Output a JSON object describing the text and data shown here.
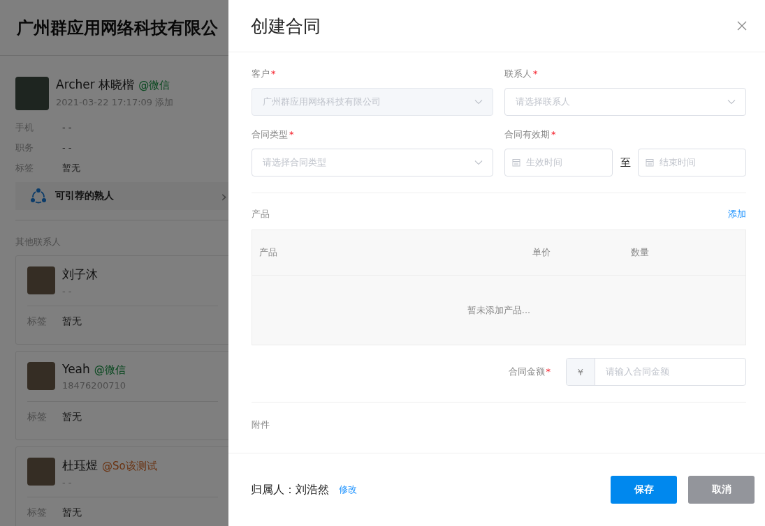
{
  "page": {
    "title": "广州群应用网络科技有限公",
    "main_contact": {
      "name": "Archer 林晓楷",
      "source": {
        "text": "@微信",
        "color": "#05461c"
      },
      "added": "2021-03-22 17:17:09 添加",
      "fields": [
        {
          "label": "手机",
          "value": "- -"
        },
        {
          "label": "职务",
          "value": "- -"
        },
        {
          "label": "标签",
          "value": "暂无"
        }
      ]
    },
    "recommend": {
      "label": "可引荐的熟人",
      "chevron": "›"
    },
    "others_title": "其他联系人",
    "contacts": [
      {
        "name": "刘子沐",
        "sub": "- -",
        "tag_label": "标签",
        "tag_value": "暂无"
      },
      {
        "name": "Yeah",
        "source": {
          "text": "@微信",
          "color": "#05461c"
        },
        "sub": "18476200710",
        "tag_label": "标签",
        "tag_value": "暂无"
      },
      {
        "name": "杜珏煜",
        "source": {
          "text": "@So该测试",
          "color": "#6a3210"
        },
        "sub": "- -",
        "tag_label": "标签",
        "tag_value": "暂无"
      }
    ]
  },
  "drawer": {
    "title": "创建合同",
    "customer": {
      "label": "客户",
      "required_mark": "*",
      "value": "广州群应用网络科技有限公司",
      "disabled": true
    },
    "contact": {
      "label": "联系人",
      "required_mark": "*",
      "placeholder": "请选择联系人"
    },
    "type": {
      "label": "合同类型",
      "required_mark": "*",
      "placeholder": "请选择合同类型"
    },
    "period": {
      "label": "合同有效期",
      "required_mark": "*",
      "start_placeholder": "生效时间",
      "separator": "至",
      "end_placeholder": "结束时间"
    },
    "products": {
      "label": "产品",
      "add_link": "添加",
      "columns": [
        "产品",
        "单价",
        "数量"
      ],
      "empty": "暂未添加产品..."
    },
    "amount": {
      "label": "合同金额",
      "required_mark": "*",
      "prefix": "¥",
      "placeholder": "请输入合同金额"
    },
    "attachment": {
      "label": "附件"
    },
    "footer": {
      "owner_label": "归属人：刘浩然",
      "edit_link": "修改",
      "buttons": [
        {
          "label": "保存",
          "kind": "primary"
        },
        {
          "label": "取消",
          "kind": "secondary"
        }
      ]
    }
  }
}
